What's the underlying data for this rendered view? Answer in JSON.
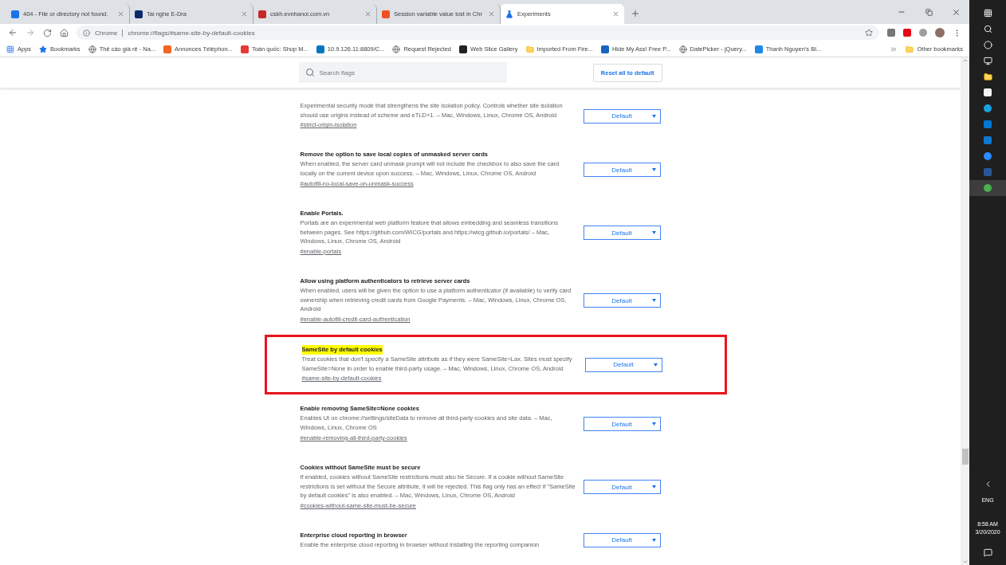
{
  "tabs": [
    {
      "title": "404 - File or directory not found.",
      "selected": false,
      "color": "#1a73e8"
    },
    {
      "title": "Tai nghe E-Dra",
      "selected": false,
      "color": "#0b2a6b"
    },
    {
      "title": "cskh.evnhanoi.com.vn",
      "selected": false,
      "color": "#c62828"
    },
    {
      "title": "Session variable value lost in Chr",
      "selected": false,
      "color": "#f25022"
    },
    {
      "title": "Experiments",
      "selected": true,
      "color": "#1a73e8"
    }
  ],
  "address": {
    "site_label": "Chrome",
    "url": "chrome://flags/#same-site-by-default-cookies"
  },
  "bookmarks": [
    {
      "label": "Apps",
      "kind": "apps"
    },
    {
      "label": "Bookmarks",
      "kind": "star"
    },
    {
      "label": "Thẻ cào giá rẻ - Na...",
      "kind": "globe"
    },
    {
      "label": "Annonces Téléphon...",
      "kind": "site",
      "color": "#f26522"
    },
    {
      "label": "Toàn quốc: Shop M...",
      "kind": "site",
      "color": "#e53935"
    },
    {
      "label": "10.9.126.11:8809/C...",
      "kind": "site",
      "color": "#0277bd"
    },
    {
      "label": "Request Rejected",
      "kind": "globe"
    },
    {
      "label": "Web Slice Gallery",
      "kind": "site",
      "color": "#222222"
    },
    {
      "label": "Imported From Fire...",
      "kind": "folder"
    },
    {
      "label": "Hide My Ass! Free P...",
      "kind": "site",
      "color": "#1565c0"
    },
    {
      "label": "DatePicker - jQuery...",
      "kind": "globe"
    },
    {
      "label": "Thanh Nguyen's Bl...",
      "kind": "site",
      "color": "#1e88e5"
    }
  ],
  "other_bookmarks": "Other bookmarks",
  "search": {
    "placeholder": "Search flags"
  },
  "reset_button": "Reset all to default",
  "flags": [
    {
      "description": "Experimental security mode that strengthens the site isolation policy. Controls whether site isolation should use origins instead of scheme and eTLD+1. – Mac, Windows, Linux, Chrome OS, Android",
      "link": "#strict-origin-isolation",
      "value": "Default",
      "highlighted": false
    },
    {
      "title": "Remove the option to save local copies of unmasked server cards",
      "description": "When enabled, the server card unmask prompt will not include the checkbox to also save the card locally on the current device upon success. – Mac, Windows, Linux, Chrome OS, Android",
      "link": "#autofill-no-local-save-on-unmask-success",
      "value": "Default",
      "highlighted": false
    },
    {
      "title": "Enable Portals.",
      "description": "Portals are an experimental web platform feature that allows embedding and seamless transitions between pages. See https://github.com/WICG/portals and https://wicg.github.io/portals/ – Mac, Windows, Linux, Chrome OS, Android",
      "link": "#enable-portals",
      "value": "Default",
      "highlighted": false
    },
    {
      "title": "Allow using platform authenticators to retrieve server cards",
      "description": "When enabled, users will be given the option to use a platform authenticator (if available) to verify card ownership when retrieving credit cards from Google Payments. – Mac, Windows, Linux, Chrome OS, Android",
      "link": "#enable-autofill-credit-card-authentication",
      "value": "Default",
      "highlighted": false
    },
    {
      "title": "SameSite by default cookies",
      "description": "Treat cookies that don't specify a SameSite attribute as if they were SameSite=Lax. Sites must specify SameSite=None in order to enable third-party usage. – Mac, Windows, Linux, Chrome OS, Android",
      "link": "#same-site-by-default-cookies",
      "value": "Default",
      "highlighted": true
    },
    {
      "title": "Enable removing SameSite=None cookies",
      "description": "Enables UI on chrome://settings/siteData to remove all third-party cookies and site data. – Mac, Windows, Linux, Chrome OS",
      "link": "#enable-removing-all-third-party-cookies",
      "value": "Default",
      "highlighted": false
    },
    {
      "title": "Cookies without SameSite must be secure",
      "description": "If enabled, cookies without SameSite restrictions must also be Secure. If a cookie without SameSite restrictions is set without the Secure attribute, it will be rejected. This flag only has an effect if \"SameSite by default cookies\" is also enabled. – Mac, Windows, Linux, Chrome OS, Android",
      "link": "#cookies-without-same-site-must-be-secure",
      "value": "Default",
      "highlighted": false
    },
    {
      "title": "Enterprise cloud reporting in browser",
      "description": "Enable the enterprise cloud reporting in browser without installing the reporting companion",
      "value": "Default",
      "highlighted": false
    }
  ],
  "taskbar": {
    "language": "ENG",
    "time": "8:58 AM",
    "date": "3/20/2020"
  }
}
